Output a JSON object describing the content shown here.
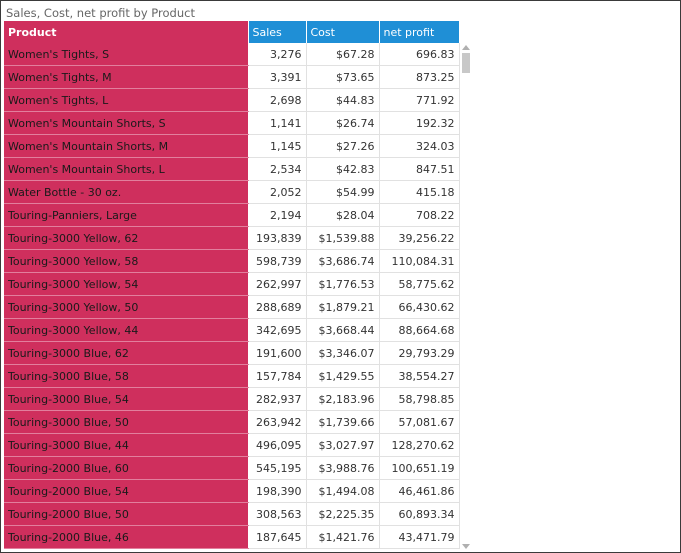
{
  "visual": {
    "title": "Sales, Cost, net profit by Product",
    "columns": [
      "Product",
      "Sales",
      "Cost",
      "net profit"
    ],
    "rows": [
      {
        "product": "Women's Tights, S",
        "sales": "3,276",
        "cost": "$67.28",
        "net_profit": "696.83"
      },
      {
        "product": "Women's Tights, M",
        "sales": "3,391",
        "cost": "$73.65",
        "net_profit": "873.25"
      },
      {
        "product": "Women's Tights, L",
        "sales": "2,698",
        "cost": "$44.83",
        "net_profit": "771.92"
      },
      {
        "product": "Women's Mountain Shorts, S",
        "sales": "1,141",
        "cost": "$26.74",
        "net_profit": "192.32"
      },
      {
        "product": "Women's Mountain Shorts, M",
        "sales": "1,145",
        "cost": "$27.26",
        "net_profit": "324.03"
      },
      {
        "product": "Women's Mountain Shorts, L",
        "sales": "2,534",
        "cost": "$42.83",
        "net_profit": "847.51"
      },
      {
        "product": "Water Bottle - 30 oz.",
        "sales": "2,052",
        "cost": "$54.99",
        "net_profit": "415.18"
      },
      {
        "product": "Touring-Panniers, Large",
        "sales": "2,194",
        "cost": "$28.04",
        "net_profit": "708.22"
      },
      {
        "product": "Touring-3000 Yellow, 62",
        "sales": "193,839",
        "cost": "$1,539.88",
        "net_profit": "39,256.22"
      },
      {
        "product": "Touring-3000 Yellow, 58",
        "sales": "598,739",
        "cost": "$3,686.74",
        "net_profit": "110,084.31"
      },
      {
        "product": "Touring-3000 Yellow, 54",
        "sales": "262,997",
        "cost": "$1,776.53",
        "net_profit": "58,775.62"
      },
      {
        "product": "Touring-3000 Yellow, 50",
        "sales": "288,689",
        "cost": "$1,879.21",
        "net_profit": "66,430.62"
      },
      {
        "product": "Touring-3000 Yellow, 44",
        "sales": "342,695",
        "cost": "$3,668.44",
        "net_profit": "88,664.68"
      },
      {
        "product": "Touring-3000 Blue, 62",
        "sales": "191,600",
        "cost": "$3,346.07",
        "net_profit": "29,793.29"
      },
      {
        "product": "Touring-3000 Blue, 58",
        "sales": "157,784",
        "cost": "$1,429.55",
        "net_profit": "38,554.27"
      },
      {
        "product": "Touring-3000 Blue, 54",
        "sales": "282,937",
        "cost": "$2,183.96",
        "net_profit": "58,798.85"
      },
      {
        "product": "Touring-3000 Blue, 50",
        "sales": "263,942",
        "cost": "$1,739.66",
        "net_profit": "57,081.67"
      },
      {
        "product": "Touring-3000 Blue, 44",
        "sales": "496,095",
        "cost": "$3,027.97",
        "net_profit": "128,270.62"
      },
      {
        "product": "Touring-2000 Blue, 60",
        "sales": "545,195",
        "cost": "$3,988.76",
        "net_profit": "100,651.19"
      },
      {
        "product": "Touring-2000 Blue, 54",
        "sales": "198,390",
        "cost": "$1,494.08",
        "net_profit": "46,461.86"
      },
      {
        "product": "Touring-2000 Blue, 50",
        "sales": "308,563",
        "cost": "$2,225.35",
        "net_profit": "60,893.34"
      },
      {
        "product": "Touring-2000 Blue, 46",
        "sales": "187,645",
        "cost": "$1,421.76",
        "net_profit": "43,471.79"
      }
    ]
  },
  "colors": {
    "product_column": "#cf2f5d",
    "value_header": "#1f8fd6",
    "frame_border": "#3a3a3a"
  },
  "icons": {
    "scroll_up": "scroll-up-arrow-icon",
    "scroll_down": "scroll-down-arrow-icon"
  }
}
